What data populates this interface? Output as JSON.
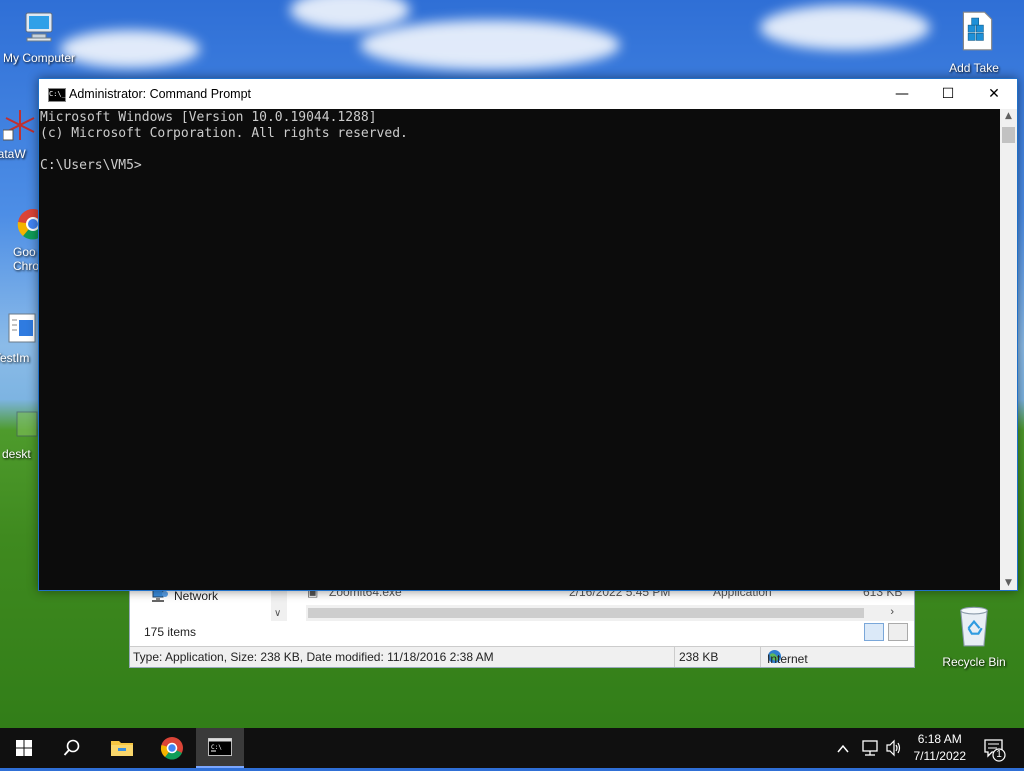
{
  "desktop": {
    "icons_left": [
      {
        "label": "My Computer"
      },
      {
        "label": "DataW"
      },
      {
        "label": "Goo\nChro"
      },
      {
        "label": "TestIm"
      },
      {
        "label": "deskt"
      }
    ],
    "icons_right": [
      {
        "label": "Add Take"
      },
      {
        "label": "Recycle Bin"
      }
    ]
  },
  "explorer": {
    "nav_item": "Network",
    "file_name": "Zoomit64.exe",
    "file_date": "2/16/2022 5:45 PM",
    "file_type": "Application",
    "file_size": "613 KB",
    "item_count": "175 items",
    "status_text": "Type: Application, Size: 238 KB, Date modified: 11/18/2016 2:38 AM",
    "status_size": "238 KB",
    "status_zone": "Internet"
  },
  "cmd": {
    "title": "Administrator: Command Prompt",
    "icon_text": "C:\\_",
    "minimize": "—",
    "maximize": "☐",
    "close": "✕",
    "lines": [
      "Microsoft Windows [Version 10.0.19044.1288]",
      "(c) Microsoft Corporation. All rights reserved.",
      "",
      "C:\\Users\\VM5>"
    ]
  },
  "taskbar": {
    "time": "6:18 AM",
    "date": "7/11/2022",
    "notification_count": "1",
    "tray_chevron": "^"
  },
  "colors": {
    "console_bg": "#0c0c0c",
    "console_text": "#cccccc",
    "taskbar_bg": "#101010"
  }
}
